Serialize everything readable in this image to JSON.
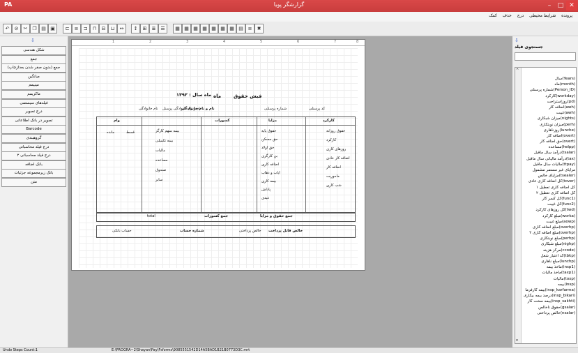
{
  "window": {
    "title": "گزارشگر پویا"
  },
  "menu": [
    "پرونده",
    "شرایط محیطی",
    "درج",
    "حذف",
    "کمک"
  ],
  "left_buttons": [
    "شکل هندسی",
    "جمع",
    "جمع (بدون صفر شدن بعدازچاپ)",
    "میانگین",
    "مینیمم",
    "ماکزیمم",
    "فیلدهای سیستمی",
    "درج تصویر",
    "تصویر در بانک اطلاعاتی",
    "Barcode",
    "گروهبندی",
    "درج فیلد محاسباتی",
    "درج فیلد محاسباتی ۲",
    "بانک اضافه",
    "بانک زیرمجموعه جزئیات",
    "متن"
  ],
  "right_panel": {
    "header": "جستجوی فیلد",
    "fields": [
      "سال(Years)",
      "ماه(month)",
      "شماره پرسنلی(Person_ID)",
      "کارکرد(workday)",
      "روزاستراحت(pd)",
      "اضافه کار(awh)",
      "غیبت(awh)",
      "میزان شبکاری(nights)",
      "میزان نوبتکاری(perh)",
      "روزناهاری(lunche)",
      "اضافه کار(overt)",
      "حق اضافه کار(overt)",
      "مساعده(helpp)",
      "درآمد سال ماقبل(tsalar)",
      "درآمد مالیاتی سال ماقبل(tax)",
      "مالیات سال ماقبل(ttpay)",
      "مزایای غیر مستمر مشمول",
      "مزایای خالص(tsealer)",
      "کل اضافه کاری عادی(tover)",
      "کل اضافه کاری تعطیل ۱",
      "کل اضافه کاری تعطیل ۲",
      "کل کسر کار(func1)",
      "کل غیبت(func2)",
      "کل روزهای کارکرد(twd)",
      "مبلغ کارکرد(worka)",
      "مبلغ غیبت(aowp)",
      "مبلغ اضافه کاری(overhp)",
      "مبلغ اضافه کاری ۲(overhp)",
      "مبلغ نوبتکاری(perhp)",
      "مبلغ شبکاری(nighp)",
      "مرکز هزینه(ccode)",
      "کد اعتبار شغل(tbkp)",
      "مبلغ ناهاری(lunchp)",
      "ماخذ بیمه(insp1)",
      "ماخذ مالیات(taxp1)",
      "مالیات(toxp)",
      "بیمه(insp)",
      "بیمه کارفرما(insp_karfarma)",
      "درصد بیمه بیکاری(insp_bikari)",
      "بیمه سخت کار(insp_sakhti)",
      "حقوق ناخالص(gsalar)",
      "خالص پرداختی(nsalar)"
    ]
  },
  "report": {
    "title_prefix": "فیش حقوق",
    "month_label": "ماه",
    "year_label": "ماه سال : ۱۳۹۲",
    "name_label": "نام و نام خانوادگی",
    "name_value": "نام و نام خانوادگی پرسنل",
    "name_value2": "نام خانوادگی",
    "personnel_code": "کد پرسنلی",
    "personnel_code_value": "شماره پرسنلی",
    "sections": {
      "work": "کارکرد",
      "benefits": "مزایا",
      "deductions": "کسورات",
      "loan": "وام"
    },
    "work_items": [
      "حقوق روزانه",
      "کارکرد",
      "روزهای کاری",
      "اضافه کار عادی",
      "اضافه کار",
      "ماموریت",
      "شب کاری"
    ],
    "benefit_items": [
      "حقوق پایه",
      "حق مسکن",
      "حق اولاد",
      "بن کارگری",
      "اضافه کاری",
      "ایاب و ذهاب",
      "بیمه کاری",
      "پاداش",
      "عیدی"
    ],
    "deduction_items": [
      "بیمه سهم کارگر",
      "بیمه تکمیلی",
      "مالیات",
      "مساعده",
      "صندوق",
      "سایر"
    ],
    "loan_items": [
      "مانده",
      "قسط"
    ],
    "sum_benefits": "جمع حقوق و مزایا",
    "sum_deductions": "جمع کسورات",
    "net_pay": "خالص قابل پرداخت",
    "account_no": "شماره حساب",
    "bank_label": "حساب بانکی",
    "net_label": "خالص پرداختی",
    "total_field": "total"
  },
  "status": {
    "undo": "Undo Steps Count:1",
    "path": "E:\\PROGRA~2\\Shayan\\Pay\\Fsforms\\9085551542D14A5BAD1B21B0773D3C.mrt"
  }
}
